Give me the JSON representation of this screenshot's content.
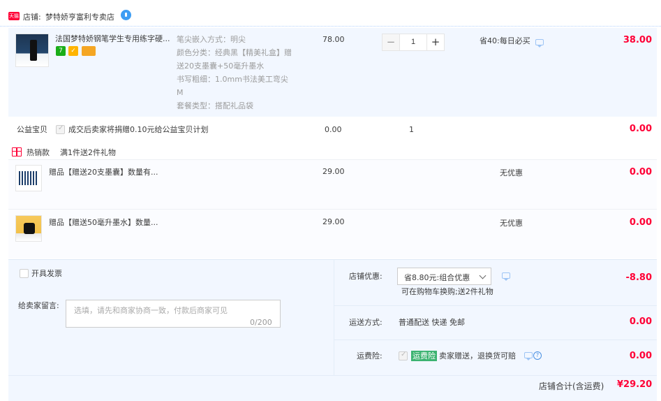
{
  "shop": {
    "badge": "天猫",
    "label": "店铺:",
    "name": "梦特娇亨富利专卖店"
  },
  "main_item": {
    "title": "法国梦特娇钢笔学生专用练字硬...",
    "tags": [
      {
        "text": "7",
        "color": "#1aad19"
      },
      {
        "text": "",
        "color": "#ffb400"
      },
      {
        "text": "",
        "color": "#f5a623"
      }
    ],
    "sku": [
      "笔尖嵌入方式：明尖",
      "颜色分类：经典黑【精美礼盒】赠",
      "送20支墨囊+50毫升墨水",
      "书写粗细：1.0mm书法美工弯尖",
      "M",
      "套餐类型：搭配礼品袋"
    ],
    "price": "78.00",
    "quantity": "1",
    "qty_minus": "−",
    "qty_plus": "+",
    "promo": "省40:每日必买",
    "amount": "38.00"
  },
  "charity": {
    "label": "公益宝贝",
    "text": "成交后卖家将捐赠0.10元给公益宝贝计划",
    "price": "0.00",
    "quantity": "1",
    "amount": "0.00"
  },
  "gift_header": {
    "label": "热销款",
    "text": "满1件送2件礼物"
  },
  "gifts": [
    {
      "title": "赠品【赠送20支墨囊】数量有...",
      "price": "29.00",
      "promo": "无优惠",
      "amount": "0.00"
    },
    {
      "title": "赠品【赠送50毫升墨水】数量...",
      "price": "29.00",
      "promo": "无优惠",
      "amount": "0.00"
    }
  ],
  "invoice": {
    "label": "开具发票"
  },
  "remark": {
    "label": "给卖家留言:",
    "placeholder": "选填，请先和商家协商一致，付款后商家可见",
    "count": "0/200"
  },
  "discount": {
    "label": "店铺优惠:",
    "selected": "省8.80元:组合优惠",
    "note": "可在购物车换购;送2件礼物",
    "amount": "-8.80"
  },
  "shipping": {
    "label": "运送方式:",
    "method": "普通配送 快递 免邮",
    "amount": "0.00"
  },
  "insurance": {
    "label": "运费险:",
    "tag": "运费险",
    "text": "卖家赠送，退换货可赔",
    "help": "?",
    "amount": "0.00"
  },
  "total": {
    "label": "店铺合计(含运费)",
    "value": "¥29.20"
  },
  "colors": {
    "accent_red": "#ff0036",
    "light_blue_bg": "#f2f7ff",
    "green_tag": "#3cb371"
  }
}
